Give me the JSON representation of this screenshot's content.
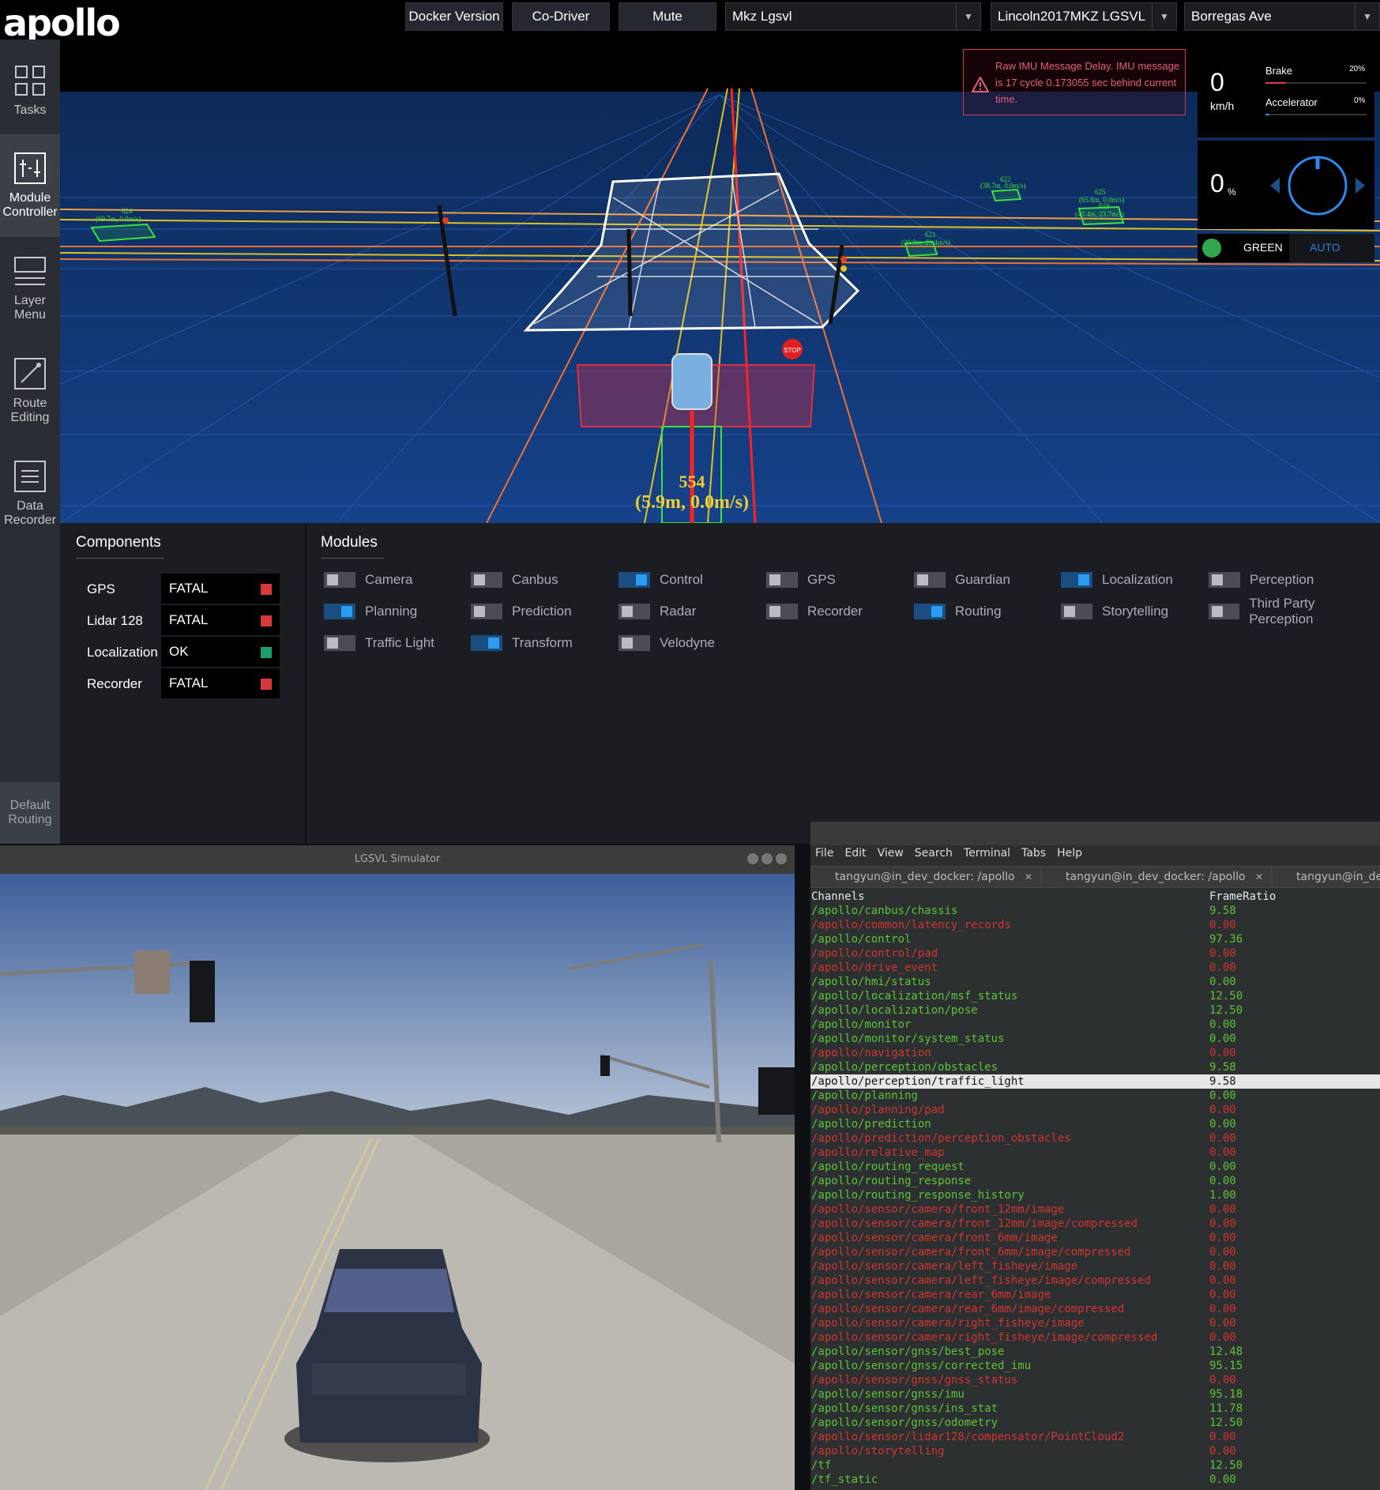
{
  "header": {
    "logo": "apollo",
    "buttons": [
      "Docker Version",
      "Co-Driver",
      "Mute"
    ],
    "selects": [
      "Mkz Lgsvl",
      "Lincoln2017MKZ LGSVL",
      "Borregas Ave"
    ]
  },
  "sidebar": {
    "items": [
      {
        "label": "Tasks",
        "icon": "tasks-icon"
      },
      {
        "label": "Module Controller",
        "icon": "module-controller-icon"
      },
      {
        "label": "Layer Menu",
        "icon": "layer-menu-icon"
      },
      {
        "label": "Route Editing",
        "icon": "route-editing-icon"
      },
      {
        "label": "Data Recorder",
        "icon": "data-recorder-icon"
      }
    ],
    "default_routing": "Default Routing"
  },
  "scene": {
    "alert": "Raw IMU Message Delay. IMU message is 17 cycle 0.173055 sec behind current time.",
    "speed": {
      "value": "0",
      "unit": "km/h"
    },
    "brake": {
      "label": "Brake",
      "value": "20%",
      "level": 0.2
    },
    "accelerator": {
      "label": "Accelerator",
      "value": "0%",
      "level": 0.0
    },
    "steering": {
      "value": "0",
      "unit": "%"
    },
    "traffic_light": "GREEN",
    "driving_mode": "AUTO",
    "ego_label": {
      "id": "554",
      "detail": "(5.9m, 0.0m/s)"
    },
    "obstacle_labels": [
      {
        "id": "624",
        "detail": "(69.7m, 0.0m/s)"
      },
      {
        "id": "622",
        "detail": "(38.7m, 0.0m/s)"
      },
      {
        "id": "625",
        "detail": "(65.8m, 0.0m/s)"
      },
      {
        "id": "619",
        "detail": "(43.4m, 23.7m/s)"
      },
      {
        "id": "621",
        "detail": "(20.9m, 20.4m/s)"
      }
    ],
    "stop_sign": "STOP"
  },
  "components": {
    "title": "Components",
    "items": [
      {
        "name": "GPS",
        "status": "FATAL",
        "color": "#d43a3a"
      },
      {
        "name": "Lidar 128",
        "status": "FATAL",
        "color": "#d43a3a"
      },
      {
        "name": "Localization",
        "status": "OK",
        "color": "#1f9e6a"
      },
      {
        "name": "Recorder",
        "status": "FATAL",
        "color": "#d43a3a"
      }
    ]
  },
  "modules": {
    "title": "Modules",
    "items": [
      {
        "name": "Camera",
        "on": false
      },
      {
        "name": "Canbus",
        "on": false
      },
      {
        "name": "Control",
        "on": true
      },
      {
        "name": "GPS",
        "on": false
      },
      {
        "name": "Guardian",
        "on": false
      },
      {
        "name": "Localization",
        "on": true
      },
      {
        "name": "Perception",
        "on": false
      },
      {
        "name": "Planning",
        "on": true
      },
      {
        "name": "Prediction",
        "on": false
      },
      {
        "name": "Radar",
        "on": false
      },
      {
        "name": "Recorder",
        "on": false
      },
      {
        "name": "Routing",
        "on": true
      },
      {
        "name": "Storytelling",
        "on": false
      },
      {
        "name": "Third Party Perception",
        "on": false
      },
      {
        "name": "Traffic Light",
        "on": false
      },
      {
        "name": "Transform",
        "on": true
      },
      {
        "name": "Velodyne",
        "on": false
      }
    ]
  },
  "simulator": {
    "title": "LGSVL Simulator"
  },
  "terminal": {
    "menu": [
      "File",
      "Edit",
      "View",
      "Search",
      "Terminal",
      "Tabs",
      "Help"
    ],
    "tabs": [
      "tangyun@in_dev_docker: /apollo",
      "tangyun@in_dev_docker: /apollo",
      "tangyun@in_de"
    ],
    "header": {
      "channel": "Channels",
      "ratio": "FrameRatio"
    },
    "rows": [
      {
        "channel": "/apollo/canbus/chassis",
        "ratio": "9.58",
        "ok": true
      },
      {
        "channel": "/apollo/common/latency_records",
        "ratio": "0.00",
        "ok": false
      },
      {
        "channel": "/apollo/control",
        "ratio": "97.36",
        "ok": true
      },
      {
        "channel": "/apollo/control/pad",
        "ratio": "0.00",
        "ok": false
      },
      {
        "channel": "/apollo/drive_event",
        "ratio": "0.00",
        "ok": false
      },
      {
        "channel": "/apollo/hmi/status",
        "ratio": "0.00",
        "ok": true
      },
      {
        "channel": "/apollo/localization/msf_status",
        "ratio": "12.50",
        "ok": true
      },
      {
        "channel": "/apollo/localization/pose",
        "ratio": "12.50",
        "ok": true
      },
      {
        "channel": "/apollo/monitor",
        "ratio": "0.00",
        "ok": true
      },
      {
        "channel": "/apollo/monitor/system_status",
        "ratio": "0.00",
        "ok": true
      },
      {
        "channel": "/apollo/navigation",
        "ratio": "0.00",
        "ok": false
      },
      {
        "channel": "/apollo/perception/obstacles",
        "ratio": "9.58",
        "ok": true
      },
      {
        "channel": "/apollo/perception/traffic_light",
        "ratio": "9.58",
        "ok": true,
        "selected": true
      },
      {
        "channel": "/apollo/planning",
        "ratio": "0.00",
        "ok": true
      },
      {
        "channel": "/apollo/planning/pad",
        "ratio": "0.00",
        "ok": false
      },
      {
        "channel": "/apollo/prediction",
        "ratio": "0.00",
        "ok": true
      },
      {
        "channel": "/apollo/prediction/perception_obstacles",
        "ratio": "0.00",
        "ok": false
      },
      {
        "channel": "/apollo/relative_map",
        "ratio": "0.00",
        "ok": false
      },
      {
        "channel": "/apollo/routing_request",
        "ratio": "0.00",
        "ok": true
      },
      {
        "channel": "/apollo/routing_response",
        "ratio": "0.00",
        "ok": true
      },
      {
        "channel": "/apollo/routing_response_history",
        "ratio": "1.00",
        "ok": true
      },
      {
        "channel": "/apollo/sensor/camera/front_12mm/image",
        "ratio": "0.00",
        "ok": false
      },
      {
        "channel": "/apollo/sensor/camera/front_12mm/image/compressed",
        "ratio": "0.00",
        "ok": false
      },
      {
        "channel": "/apollo/sensor/camera/front_6mm/image",
        "ratio": "0.00",
        "ok": false
      },
      {
        "channel": "/apollo/sensor/camera/front_6mm/image/compressed",
        "ratio": "0.00",
        "ok": false
      },
      {
        "channel": "/apollo/sensor/camera/left_fisheye/image",
        "ratio": "0.00",
        "ok": false
      },
      {
        "channel": "/apollo/sensor/camera/left_fisheye/image/compressed",
        "ratio": "0.00",
        "ok": false
      },
      {
        "channel": "/apollo/sensor/camera/rear_6mm/image",
        "ratio": "0.00",
        "ok": false
      },
      {
        "channel": "/apollo/sensor/camera/rear_6mm/image/compressed",
        "ratio": "0.00",
        "ok": false
      },
      {
        "channel": "/apollo/sensor/camera/right_fisheye/image",
        "ratio": "0.00",
        "ok": false
      },
      {
        "channel": "/apollo/sensor/camera/right_fisheye/image/compressed",
        "ratio": "0.00",
        "ok": false
      },
      {
        "channel": "/apollo/sensor/gnss/best_pose",
        "ratio": "12.48",
        "ok": true
      },
      {
        "channel": "/apollo/sensor/gnss/corrected_imu",
        "ratio": "95.15",
        "ok": true
      },
      {
        "channel": "/apollo/sensor/gnss/gnss_status",
        "ratio": "0.00",
        "ok": false
      },
      {
        "channel": "/apollo/sensor/gnss/imu",
        "ratio": "95.18",
        "ok": true
      },
      {
        "channel": "/apollo/sensor/gnss/ins_stat",
        "ratio": "11.78",
        "ok": true
      },
      {
        "channel": "/apollo/sensor/gnss/odometry",
        "ratio": "12.50",
        "ok": true
      },
      {
        "channel": "/apollo/sensor/lidar128/compensator/PointCloud2",
        "ratio": "0.00",
        "ok": false
      },
      {
        "channel": "/apollo/storytelling",
        "ratio": "0.00",
        "ok": false
      },
      {
        "channel": "/tf",
        "ratio": "12.50",
        "ok": true
      },
      {
        "channel": "/tf_static",
        "ratio": "0.00",
        "ok": true
      }
    ],
    "colors": {
      "ok": "#5fc23a",
      "bad": "#d03434"
    }
  }
}
